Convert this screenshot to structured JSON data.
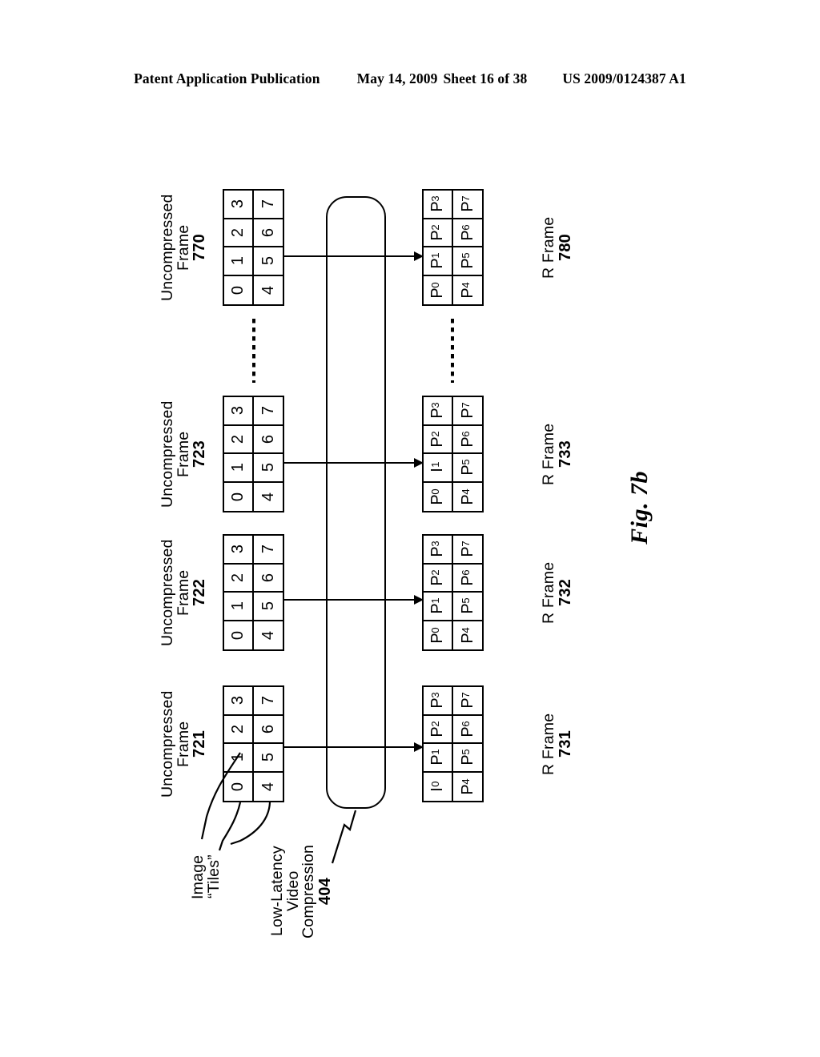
{
  "header": {
    "publication": "Patent Application Publication",
    "date": "May 14, 2009",
    "sheet": "Sheet 16 of 38",
    "patent_number": "US 2009/0124387 A1"
  },
  "figure": {
    "caption": "Fig. 7b"
  },
  "annotations": {
    "image_label": "Image",
    "tiles_label": "“Tiles”",
    "compression_line1": "Low-Latency",
    "compression_line2": "Video",
    "compression_line3": "Compression",
    "compression_ref": "404"
  },
  "frames": {
    "uncompressed": [
      {
        "name": "uncompressed-frame-721",
        "label_line1": "Uncompressed",
        "label_line2": "Frame",
        "ref": "721",
        "tiles": [
          "0",
          "1",
          "2",
          "3",
          "4",
          "5",
          "6",
          "7"
        ]
      },
      {
        "name": "uncompressed-frame-722",
        "label_line1": "Uncompressed",
        "label_line2": "Frame",
        "ref": "722",
        "tiles": [
          "0",
          "1",
          "2",
          "3",
          "4",
          "5",
          "6",
          "7"
        ]
      },
      {
        "name": "uncompressed-frame-723",
        "label_line1": "Uncompressed",
        "label_line2": "Frame",
        "ref": "723",
        "tiles": [
          "0",
          "1",
          "2",
          "3",
          "4",
          "5",
          "6",
          "7"
        ]
      },
      {
        "name": "uncompressed-frame-770",
        "label_line1": "Uncompressed",
        "label_line2": "Frame",
        "ref": "770",
        "tiles": [
          "0",
          "1",
          "2",
          "3",
          "4",
          "5",
          "6",
          "7"
        ]
      }
    ],
    "rframes": [
      {
        "name": "r-frame-731",
        "label_line1": "R Frame",
        "ref": "731",
        "tiles": [
          {
            "base": "I",
            "sub": "0"
          },
          {
            "base": "P",
            "sub": "1"
          },
          {
            "base": "P",
            "sub": "2"
          },
          {
            "base": "P",
            "sub": "3"
          },
          {
            "base": "P",
            "sub": "4"
          },
          {
            "base": "P",
            "sub": "5"
          },
          {
            "base": "P",
            "sub": "6"
          },
          {
            "base": "P",
            "sub": "7"
          }
        ]
      },
      {
        "name": "r-frame-732",
        "label_line1": "R Frame",
        "ref": "732",
        "tiles": [
          {
            "base": "P",
            "sub": "0"
          },
          {
            "base": "P",
            "sub": "1"
          },
          {
            "base": "P",
            "sub": "2"
          },
          {
            "base": "P",
            "sub": "3"
          },
          {
            "base": "P",
            "sub": "4"
          },
          {
            "base": "P",
            "sub": "5"
          },
          {
            "base": "P",
            "sub": "6"
          },
          {
            "base": "P",
            "sub": "7"
          }
        ]
      },
      {
        "name": "r-frame-733",
        "label_line1": "R Frame",
        "ref": "733",
        "tiles": [
          {
            "base": "P",
            "sub": "0"
          },
          {
            "base": "I",
            "sub": "1"
          },
          {
            "base": "P",
            "sub": "2"
          },
          {
            "base": "P",
            "sub": "3"
          },
          {
            "base": "P",
            "sub": "4"
          },
          {
            "base": "P",
            "sub": "5"
          },
          {
            "base": "P",
            "sub": "6"
          },
          {
            "base": "P",
            "sub": "7"
          }
        ]
      },
      {
        "name": "r-frame-780",
        "label_line1": "R Frame",
        "ref": "780",
        "tiles": [
          {
            "base": "P",
            "sub": "0"
          },
          {
            "base": "P",
            "sub": "1"
          },
          {
            "base": "P",
            "sub": "2"
          },
          {
            "base": "P",
            "sub": "3"
          },
          {
            "base": "P",
            "sub": "4"
          },
          {
            "base": "P",
            "sub": "5"
          },
          {
            "base": "P",
            "sub": "6"
          },
          {
            "base": "P",
            "sub": "7"
          }
        ]
      }
    ]
  }
}
